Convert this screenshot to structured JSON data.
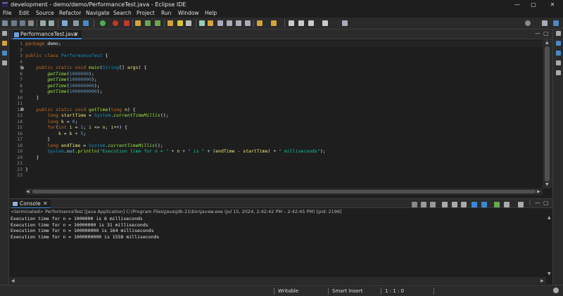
{
  "window": {
    "title": "development - demo/demo/PerformanceTest.java - Eclipse IDE",
    "minimize": "—",
    "maximize": "▢",
    "close": "✕"
  },
  "menu": [
    "File",
    "Edit",
    "Source",
    "Refactor",
    "Navigate",
    "Search",
    "Project",
    "Run",
    "Window",
    "Help"
  ],
  "editor": {
    "tab_label": "PerformanceTest.java",
    "tab_close": "✕",
    "minimize": "—",
    "maximize": "▢",
    "line_numbers": [
      "1",
      "2",
      "3",
      "4",
      "5",
      "6",
      "7",
      "8",
      "9",
      "10",
      "11",
      "12",
      "13",
      "14",
      "15",
      "16",
      "17",
      "18",
      "19",
      "20",
      "21",
      "22",
      "23"
    ],
    "code": {
      "l1": [
        "package",
        " demo;"
      ],
      "l3": [
        "public",
        " ",
        "class",
        " ",
        "PerformanceTest",
        " {"
      ],
      "l5": [
        "    ",
        "public",
        " ",
        "static",
        " ",
        "void",
        " ",
        "main",
        "(",
        "String",
        "[] ",
        "args",
        ") {"
      ],
      "l6": [
        "        ",
        "getTime",
        "(",
        "1000000",
        ");"
      ],
      "l7": [
        "        ",
        "getTime",
        "(",
        "10000000",
        ");"
      ],
      "l8": [
        "        ",
        "getTime",
        "(",
        "100000000",
        ");"
      ],
      "l9": [
        "        ",
        "getTime",
        "(",
        "1000000000",
        ");"
      ],
      "l10": [
        "    }"
      ],
      "l12": [
        "    ",
        "public",
        " ",
        "static",
        " ",
        "void",
        " ",
        "getTime",
        "(",
        "long",
        " ",
        "n",
        ") {"
      ],
      "l13": [
        "        ",
        "long",
        " ",
        "startTime",
        " = ",
        "System",
        ".",
        "currentTimeMillis",
        "();"
      ],
      "l14": [
        "        ",
        "long",
        " ",
        "k",
        " = ",
        "0",
        ";"
      ],
      "l15": [
        "        ",
        "for",
        "(",
        "int",
        " ",
        "i",
        " = ",
        "1",
        "; ",
        "i",
        " <= ",
        "n",
        "; ",
        "i",
        "++) {"
      ],
      "l16": [
        "            ",
        "k",
        " = ",
        "k",
        " + ",
        "5",
        ";"
      ],
      "l17": [
        "        }"
      ],
      "l18": [
        "        ",
        "long",
        " ",
        "endTime",
        " = ",
        "System",
        ".",
        "currentTimeMillis",
        "();"
      ],
      "l19": [
        "        ",
        "System",
        ".",
        "out",
        ".",
        "println",
        "(",
        "\"Execution time for n = \"",
        " + ",
        "n",
        " + ",
        "\" is \"",
        " + (",
        "endTime",
        " - ",
        "startTime",
        ") + ",
        "\" milliseconds\"",
        ");"
      ],
      "l20": [
        "    }"
      ],
      "l22": [
        "}"
      ]
    }
  },
  "console": {
    "tab_label": "Console",
    "tab_close": "✕",
    "status": "<terminated> PerformanceTest [Java Application] C:\\Program Files\\Java\\jdk-21\\bin\\javaw.exe  (Jul 15, 2024, 2:42:42 PM – 2:42:45 PM) [pid: 2196]",
    "output": [
      "Execution time for n = 1000000 is 6 milliseconds",
      "Execution time for n = 10000000 is 31 milliseconds",
      "Execution time for n = 100000000 is 164 milliseconds",
      "Execution time for n = 1000000000 is 1558 milliseconds"
    ]
  },
  "status_bar": {
    "writable": "Writable",
    "insert_mode": "Smart Insert",
    "position": "1 : 1 : 0"
  },
  "icons": {
    "java-file": "java-file-icon",
    "console": "console-icon"
  },
  "colors": {
    "accent": "#3b86d6",
    "keyword": "#cc6c1d",
    "method": "#a7ec21",
    "string": "#17c6a3"
  }
}
